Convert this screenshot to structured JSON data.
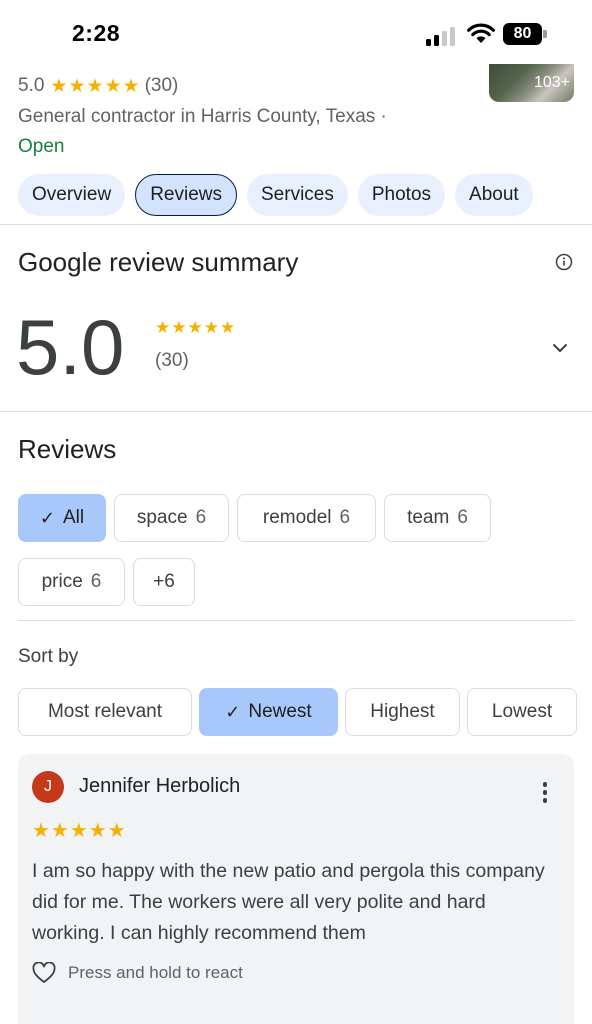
{
  "status_bar": {
    "time": "2:28",
    "battery": "80"
  },
  "business": {
    "rating": "5.0",
    "stars": "★★★★★",
    "review_count": "(30)",
    "category": "General contractor in Harris County, Texas ·",
    "status": "Open",
    "photo_count": "103+"
  },
  "tabs": [
    {
      "label": "Overview",
      "active": false
    },
    {
      "label": "Reviews",
      "active": true
    },
    {
      "label": "Services",
      "active": false
    },
    {
      "label": "Photos",
      "active": false
    },
    {
      "label": "About",
      "active": false
    }
  ],
  "summary": {
    "title": "Google review summary",
    "rating": "5.0",
    "stars": "★★★★★",
    "count": "(30)"
  },
  "reviews_section": {
    "title": "Reviews",
    "topics": [
      {
        "label": "All",
        "count": "",
        "selected": true
      },
      {
        "label": "space",
        "count": "6",
        "selected": false
      },
      {
        "label": "remodel",
        "count": "6",
        "selected": false
      },
      {
        "label": "team",
        "count": "6",
        "selected": false
      },
      {
        "label": "price",
        "count": "6",
        "selected": false
      },
      {
        "label": "+6",
        "count": "",
        "selected": false
      }
    ],
    "sort_label": "Sort by",
    "sort_options": [
      {
        "label": "Most relevant",
        "selected": false
      },
      {
        "label": "Newest",
        "selected": true
      },
      {
        "label": "Highest",
        "selected": false
      },
      {
        "label": "Lowest",
        "selected": false
      }
    ]
  },
  "review": {
    "avatar_initial": "J",
    "reviewer": "Jennifer Herbolich",
    "stars": "★★★★★",
    "rating": 5,
    "text": "I am so happy with the new patio and pergola this company did for me. The workers were all very polite and hard working. I can highly recommend them",
    "react_label": "Press and hold to react"
  },
  "colors": {
    "star": "#f6b100",
    "open": "#188038",
    "tab_bg": "#e8f0fe",
    "selected_chip": "#a8c7fa",
    "avatar": "#c5391b"
  }
}
